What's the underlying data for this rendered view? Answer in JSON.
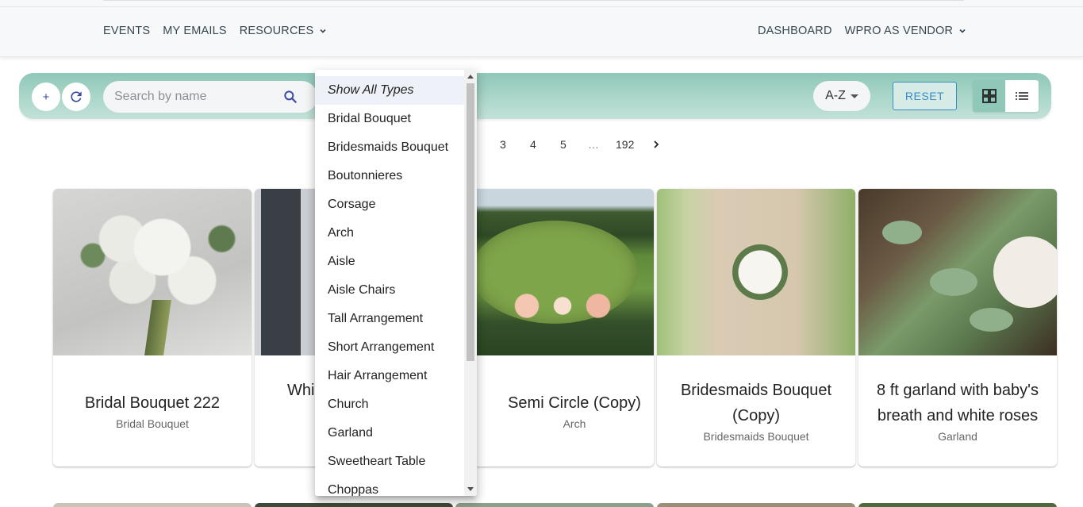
{
  "nav": {
    "left": [
      {
        "label": "EVENTS"
      },
      {
        "label": "MY EMAILS"
      },
      {
        "label": "RESOURCES",
        "has_dropdown": true
      }
    ],
    "right": [
      {
        "label": "DASHBOARD"
      },
      {
        "label": "WPRO AS VENDOR",
        "has_dropdown": true
      }
    ]
  },
  "toolbar": {
    "add_label": "+",
    "refresh_icon": "refresh-icon",
    "search_placeholder": "Search by name",
    "search_value": "",
    "sort_value": "A-Z",
    "reset_label": "RESET",
    "view_mode": "grid"
  },
  "pagination": {
    "pages": [
      "3",
      "4",
      "5",
      "…",
      "192"
    ],
    "next_icon": "chevron-right-icon"
  },
  "type_dropdown": {
    "selected": "Show All Types",
    "options": [
      "Show All Types",
      "Bridal Bouquet",
      "Bridesmaids Bouquet",
      "Boutonnieres",
      "Corsage",
      "Arch",
      "Aisle",
      "Aisle Chairs",
      "Tall Arrangement",
      "Short Arrangement",
      "Hair Arrangement",
      "Church",
      "Garland",
      "Sweetheart Table",
      "Choppas"
    ]
  },
  "cards": [
    {
      "title": "Bridal Bouquet 222",
      "subtitle": "Bridal Bouquet"
    },
    {
      "title": "Whi",
      "subtitle": ""
    },
    {
      "title": "Semi Circle (Copy)",
      "subtitle": "Arch"
    },
    {
      "title": "Bridesmaids Bouquet (Copy)",
      "subtitle": "Bridesmaids Bouquet"
    },
    {
      "title": "8 ft garland with baby's breath and white roses",
      "subtitle": "Garland"
    }
  ],
  "colors": {
    "toolbar_accent": "#8fc7b8",
    "icon_blue": "#3a4ba0",
    "reset_blue": "#3b8bc4"
  }
}
